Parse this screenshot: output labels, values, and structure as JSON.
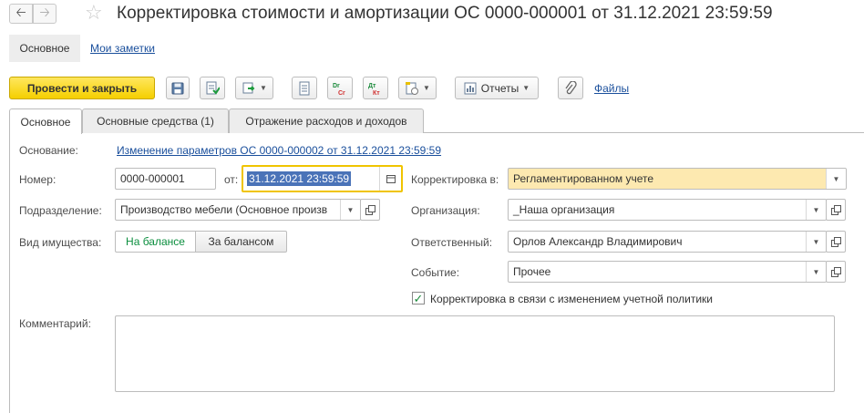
{
  "window": {
    "title": "Корректировка стоимости и амортизации ОС 0000-000001 от 31.12.2021 23:59:59"
  },
  "subnav": {
    "active": "Основное",
    "notes_link": "Мои заметки"
  },
  "toolbar": {
    "post_close_label": "Провести и закрыть",
    "reports_label": "Отчеты",
    "files_label": "Файлы"
  },
  "tabs": [
    {
      "label": "Основное",
      "active": true
    },
    {
      "label": "Основные средства (1)",
      "active": false
    },
    {
      "label": "Отражение расходов и доходов",
      "active": false
    }
  ],
  "form": {
    "basis_label": "Основание:",
    "basis_value": "Изменение параметров ОС 0000-000002 от 31.12.2021 23:59:59",
    "number_label": "Номер:",
    "number_value": "0000-000001",
    "date_label": "от:",
    "date_value": "31.12.2021 23:59:59",
    "department_label": "Подразделение:",
    "department_value": "Производство мебели (Основное произв",
    "property_label": "Вид имущества:",
    "property_on": "На балансе",
    "property_off": "За балансом",
    "correction_label": "Корректировка в:",
    "correction_value": "Регламентированном учете",
    "org_label": "Организация:",
    "org_value": "_Наша организация",
    "responsible_label": "Ответственный:",
    "responsible_value": "Орлов Александр Владимирович",
    "event_label": "Событие:",
    "event_value": "Прочее",
    "policy_checkbox_label": "Корректировка в связи с изменением учетной политики",
    "policy_checked": true,
    "comment_label": "Комментарий:",
    "comment_value": ""
  },
  "colors": {
    "primary_button": "#f5cf00",
    "link": "#1a4f9c",
    "focus_border": "#f0c400",
    "correction_bg": "#fde9b0",
    "selection": "#4a73b8",
    "segment_active_text": "#0b8e3e"
  }
}
